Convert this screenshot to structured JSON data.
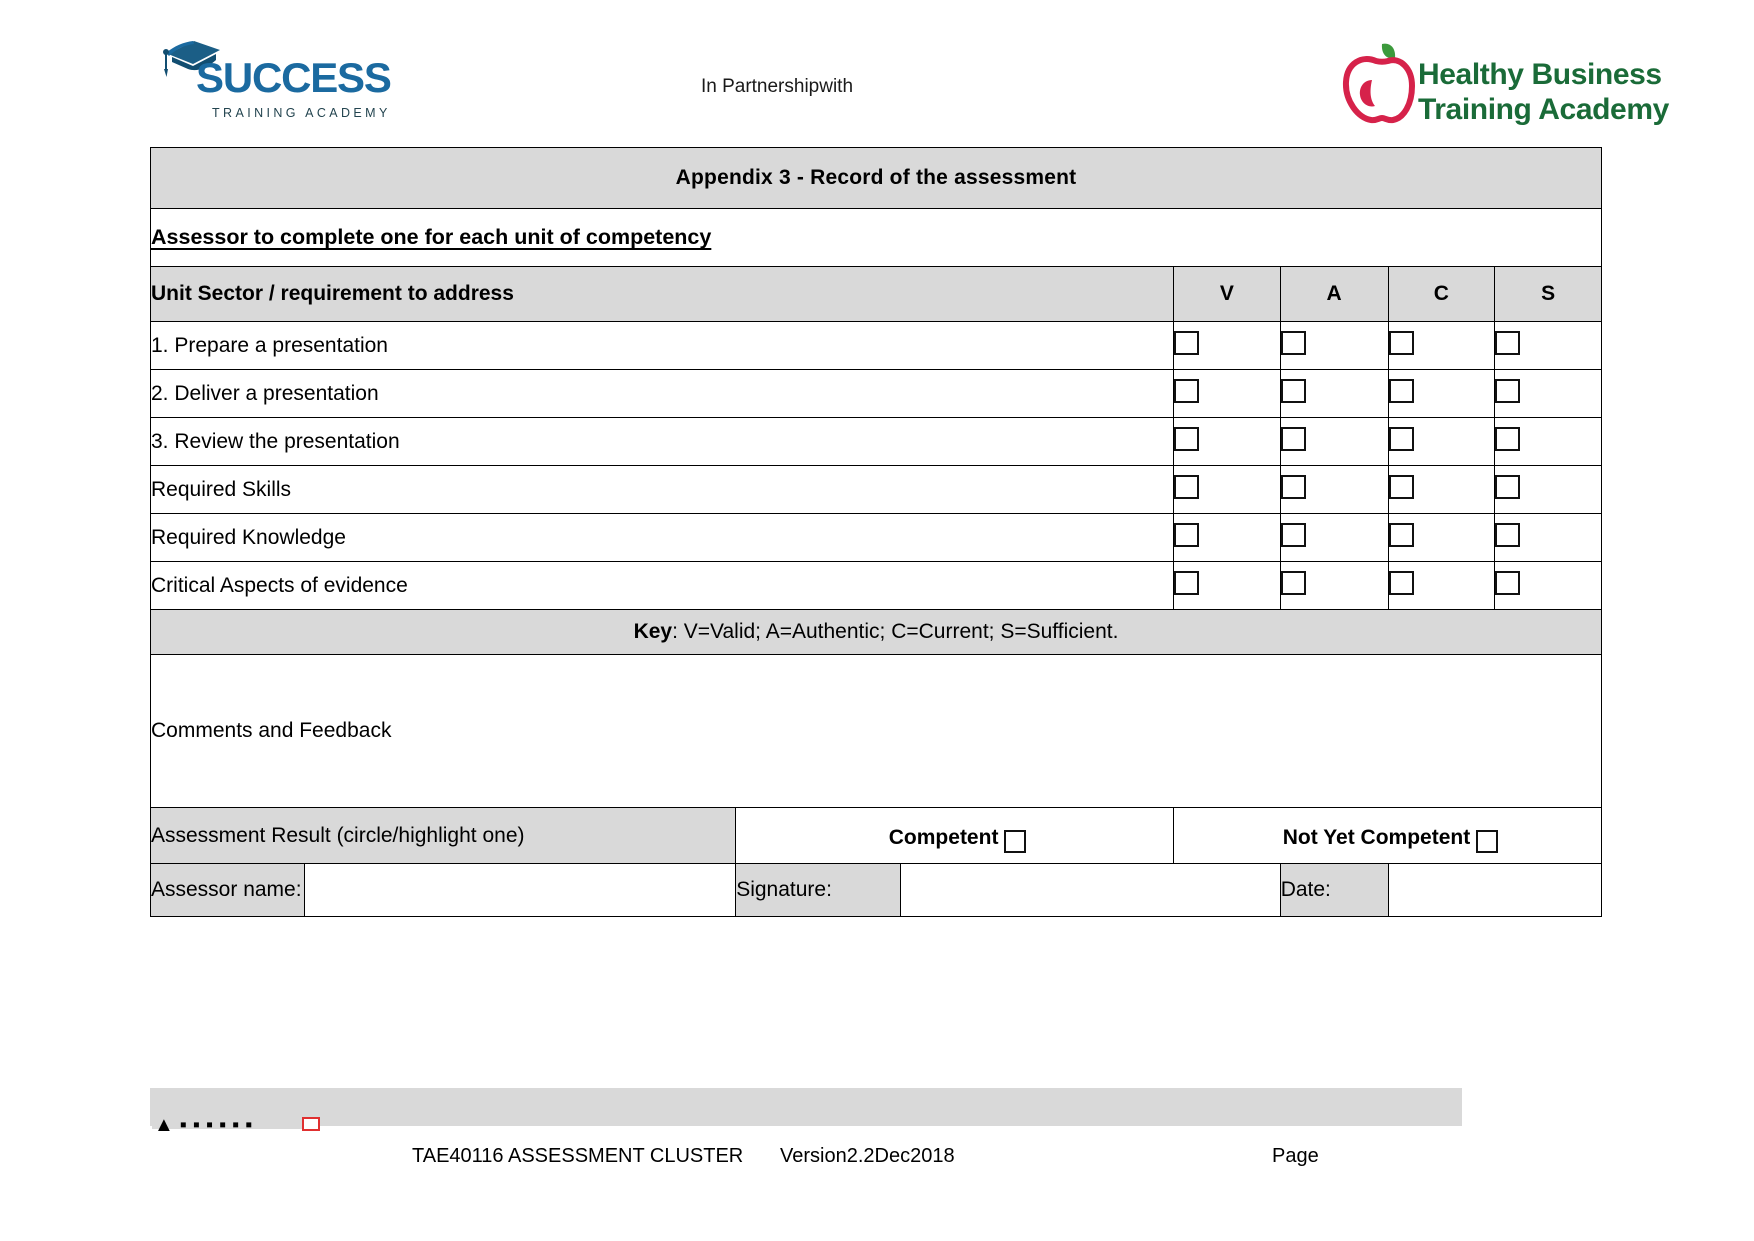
{
  "header": {
    "partnership_text": "In Partnershipwith",
    "left_logo": {
      "name": "Success Training Academy",
      "wordmark": "SUCCESS",
      "tagline": "TRAINING ACADEMY",
      "color": "#1b6aa0",
      "icon": "graduation-cap-icon"
    },
    "right_logo": {
      "name": "Healthy Business Training Academy",
      "line1": "Healthy Business",
      "line2": "Training Academy",
      "color": "#1a6b38",
      "accent_color": "#d6224a",
      "icon": "apple-icon"
    }
  },
  "document": {
    "title": "Appendix 3 - Record of the assessment",
    "subtitle": "Assessor to complete one for each unit of competency",
    "table": {
      "column_header_label": "Unit Sector / requirement to address",
      "criteria_columns": [
        "V",
        "A",
        "C",
        "S"
      ],
      "rows": [
        {
          "label": "1. Prepare a presentation",
          "V": false,
          "A": false,
          "C": false,
          "S": false
        },
        {
          "label": "2. Deliver a presentation",
          "V": false,
          "A": false,
          "C": false,
          "S": false
        },
        {
          "label": "3. Review the presentation",
          "V": false,
          "A": false,
          "C": false,
          "S": false
        },
        {
          "label": "Required Skills",
          "V": false,
          "A": false,
          "C": false,
          "S": false
        },
        {
          "label": "Required Knowledge",
          "V": false,
          "A": false,
          "C": false,
          "S": false
        },
        {
          "label": "Critical Aspects of evidence",
          "V": false,
          "A": false,
          "C": false,
          "S": false
        }
      ]
    },
    "key": {
      "prefix": "Key",
      "text": ": V=Valid; A=Authentic; C=Current; S=Sufficient."
    },
    "comments": {
      "label": "Comments and Feedback",
      "value": ""
    },
    "result": {
      "label": "Assessment Result (circle/highlight one)",
      "options": [
        {
          "label": "Competent",
          "checked": false
        },
        {
          "label": "Not Yet Competent",
          "checked": false
        }
      ]
    },
    "signoff": {
      "assessor_name_label": "Assessor name:",
      "assessor_name_value": "",
      "signature_label": "Signature:",
      "signature_value": "",
      "date_label": "Date:",
      "date_value": ""
    }
  },
  "footer": {
    "cluster": "TAE40116 ASSESSMENT CLUSTER",
    "version": "Version2.2Dec2018",
    "page": "Page"
  },
  "colors": {
    "header_fill": "#d9d9d9",
    "border": "#000000",
    "page_background": "#ffffff"
  }
}
